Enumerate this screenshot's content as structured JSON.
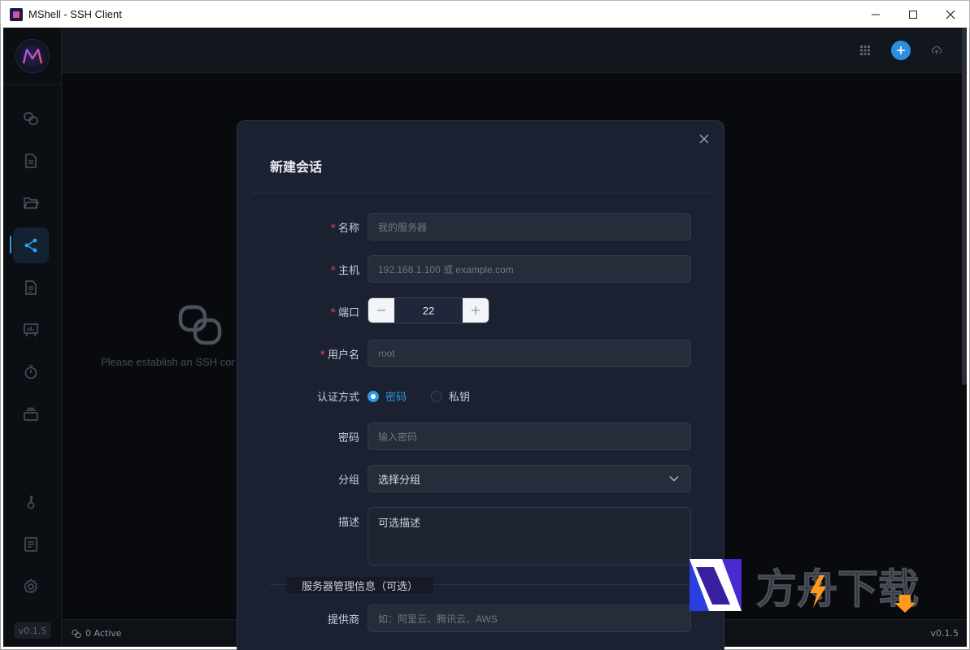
{
  "window": {
    "title": "MShell - SSH Client"
  },
  "sidebar": {
    "version": "v0.1.5",
    "items": [
      {
        "icon": "link-icon"
      },
      {
        "icon": "file-icon"
      },
      {
        "icon": "folder-icon"
      },
      {
        "icon": "share-icon",
        "active": true
      },
      {
        "icon": "document-icon"
      },
      {
        "icon": "presentation-icon"
      },
      {
        "icon": "timer-icon"
      },
      {
        "icon": "layers-icon"
      },
      {
        "icon": "key-icon"
      },
      {
        "icon": "notes-icon"
      },
      {
        "icon": "settings-icon"
      }
    ]
  },
  "main": {
    "empty_text": "Please establish an SSH cor"
  },
  "status": {
    "active": "0 Active",
    "version": "v0.1.5"
  },
  "modal": {
    "title": "新建会话",
    "fields": {
      "name": {
        "label": "名称",
        "placeholder": "我的服务器"
      },
      "host": {
        "label": "主机",
        "placeholder": "192.168.1.100 或 example.com"
      },
      "port": {
        "label": "端口",
        "value": "22"
      },
      "username": {
        "label": "用户名",
        "placeholder": "root"
      },
      "auth": {
        "label": "认证方式",
        "options": [
          "密码",
          "私钥"
        ],
        "selected": "密码"
      },
      "password": {
        "label": "密码",
        "placeholder": "输入密码"
      },
      "group": {
        "label": "分组",
        "value": "选择分组"
      },
      "description": {
        "label": "描述",
        "value": "可选描述"
      },
      "provider": {
        "label": "提供商",
        "placeholder": "如：阿里云、腾讯云、AWS"
      }
    },
    "section_legend": "服务器管理信息（可选）"
  },
  "watermark": {
    "text": "方舟下载"
  },
  "colors": {
    "accent": "#2a9be0",
    "required": "#e5484d",
    "modal_bg": "#1b2130"
  }
}
